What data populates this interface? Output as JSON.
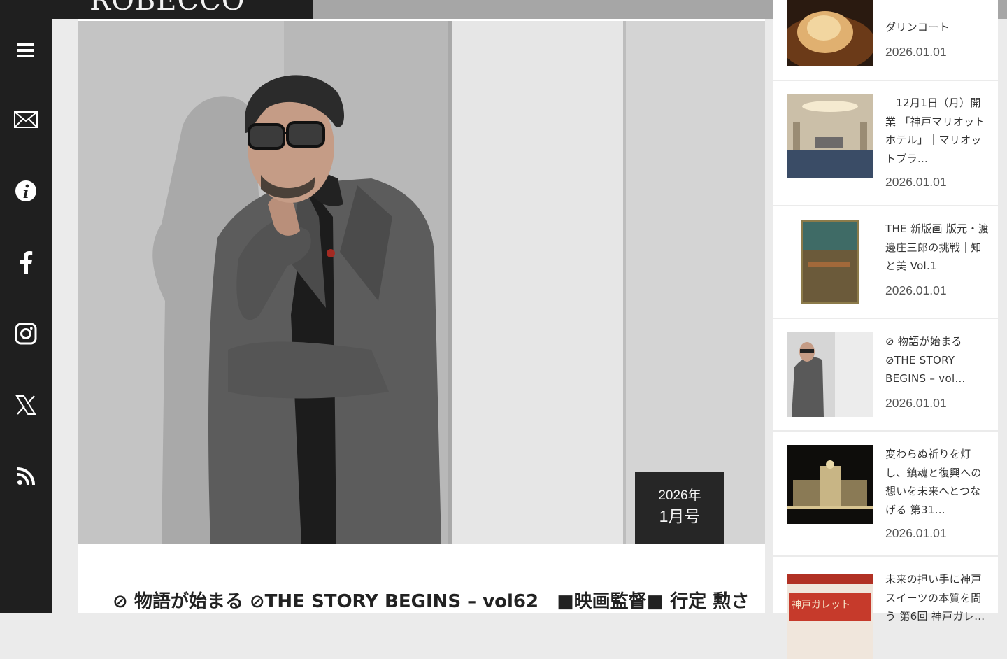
{
  "brand": {
    "logo": "ROBECCO"
  },
  "sidebar": {
    "items": [
      {
        "name": "menu",
        "icon": "hamburger-menu-icon"
      },
      {
        "name": "contact",
        "icon": "mail-icon"
      },
      {
        "name": "about",
        "icon": "info-icon"
      },
      {
        "name": "facebook",
        "icon": "facebook-icon"
      },
      {
        "name": "instagram",
        "icon": "instagram-icon"
      },
      {
        "name": "x",
        "icon": "x-icon"
      },
      {
        "name": "rss",
        "icon": "rss-icon"
      }
    ]
  },
  "article": {
    "badge_year": "2026年",
    "badge_month": "1月号",
    "title": "⊘ 物語が始まる ⊘THE STORY BEGINS – vol62　■映画監督■ 行定 勲さ"
  },
  "related": [
    {
      "title": "ダリンコート",
      "date": "2026.01.01"
    },
    {
      "title": "　12月1日（月）開業 「神戸マリオットホテル」｜マリオットブラ…",
      "date": "2026.01.01"
    },
    {
      "title": "THE 新版画 版元・渡邊庄三郎の挑戦｜知と美 Vol.1",
      "date": "2026.01.01"
    },
    {
      "title": "⊘ 物語が始まる ⊘THE STORY BEGINS – vol…",
      "date": "2026.01.01"
    },
    {
      "title": "変わらぬ祈りを灯し、鎮魂と復興への想いを未来へとつなげる 第31…",
      "date": "2026.01.01"
    },
    {
      "title": "未来の担い手に神戸スイーツの本質を問う 第6回 神戸ガレ…",
      "date": ""
    }
  ],
  "colors": {
    "sidebar_bg": "#1f1f1f",
    "page_bg": "#ebebeb",
    "badge_bg": "#262626"
  }
}
